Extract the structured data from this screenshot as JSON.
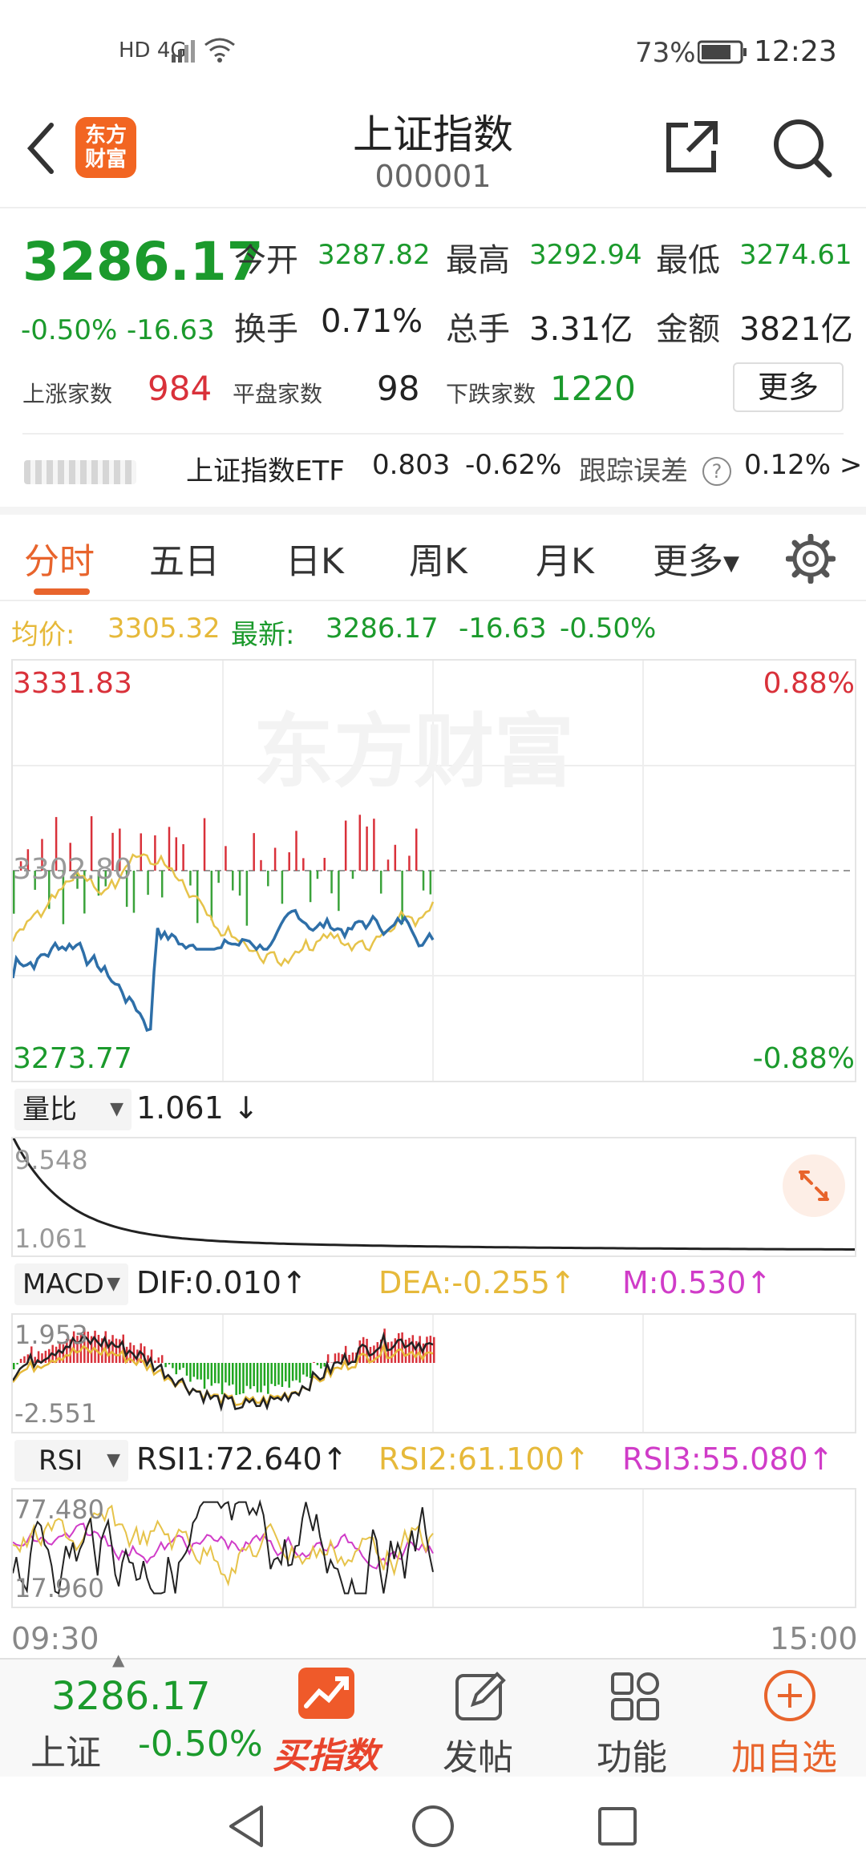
{
  "status": {
    "network": "HD 4G",
    "battery": "73%",
    "time": "12:23"
  },
  "header": {
    "title": "上证指数",
    "code": "000001",
    "logo_line1": "东方",
    "logo_line2": "财富"
  },
  "quote": {
    "price": "3286.17",
    "pct": "-0.50%",
    "change": "-16.63",
    "open_label": "今开",
    "open": "3287.82",
    "high_label": "最高",
    "high": "3292.94",
    "low_label": "最低",
    "low": "3274.61",
    "turnover_label": "换手",
    "turnover": "0.71%",
    "volume_label": "总手",
    "volume": "3.31亿",
    "amount_label": "金额",
    "amount": "3821亿",
    "up_label": "上涨家数",
    "up": "984",
    "flat_label": "平盘家数",
    "flat": "98",
    "down_label": "下跌家数",
    "down": "1220",
    "more_label": "更多"
  },
  "etf": {
    "name": "上证指数ETF",
    "price": "0.803",
    "pct": "-0.62%",
    "track_label": "跟踪误差",
    "track_value": "0.12% >"
  },
  "tabs": [
    "分时",
    "五日",
    "日K",
    "周K",
    "月K",
    "更多"
  ],
  "summary": {
    "avg_label": "均价:",
    "avg": "3305.32",
    "latest_label": "最新:",
    "latest": "3286.17",
    "change": "-16.63",
    "pct": "-0.50%"
  },
  "main_chart": {
    "y_max": "3331.83",
    "y_min": "3273.77",
    "y_mid": "3302.80",
    "pct_max": "0.88%",
    "pct_min": "-0.88%",
    "watermark": "东方财富"
  },
  "volume_ratio": {
    "label": "量比",
    "value": "1.061 ↓",
    "top": "9.548",
    "bottom": "1.061"
  },
  "macd": {
    "label": "MACD",
    "dif": "DIF:0.010↑",
    "dea": "DEA:-0.255↑",
    "m": "M:0.530↑",
    "top": "1.953",
    "bottom": "-2.551"
  },
  "rsi": {
    "label": "RSI",
    "rsi1": "RSI1:72.640↑",
    "rsi2": "RSI2:61.100↑",
    "rsi3": "RSI3:55.080↑",
    "top": "77.480",
    "bottom": "17.960"
  },
  "time_axis": {
    "start": "09:30",
    "end": "15:00"
  },
  "bottom": {
    "price": "3286.17",
    "name": "上证",
    "pct": "-0.50%",
    "buy": "买指数",
    "post": "发帖",
    "func": "功能",
    "add": "加自选"
  },
  "colors": {
    "green": "#1b9a2c",
    "red": "#d9313a",
    "orange": "#e8642c",
    "yellow": "#e6b93a",
    "blue": "#2e6fa8",
    "magenta": "#d03cc8"
  }
}
